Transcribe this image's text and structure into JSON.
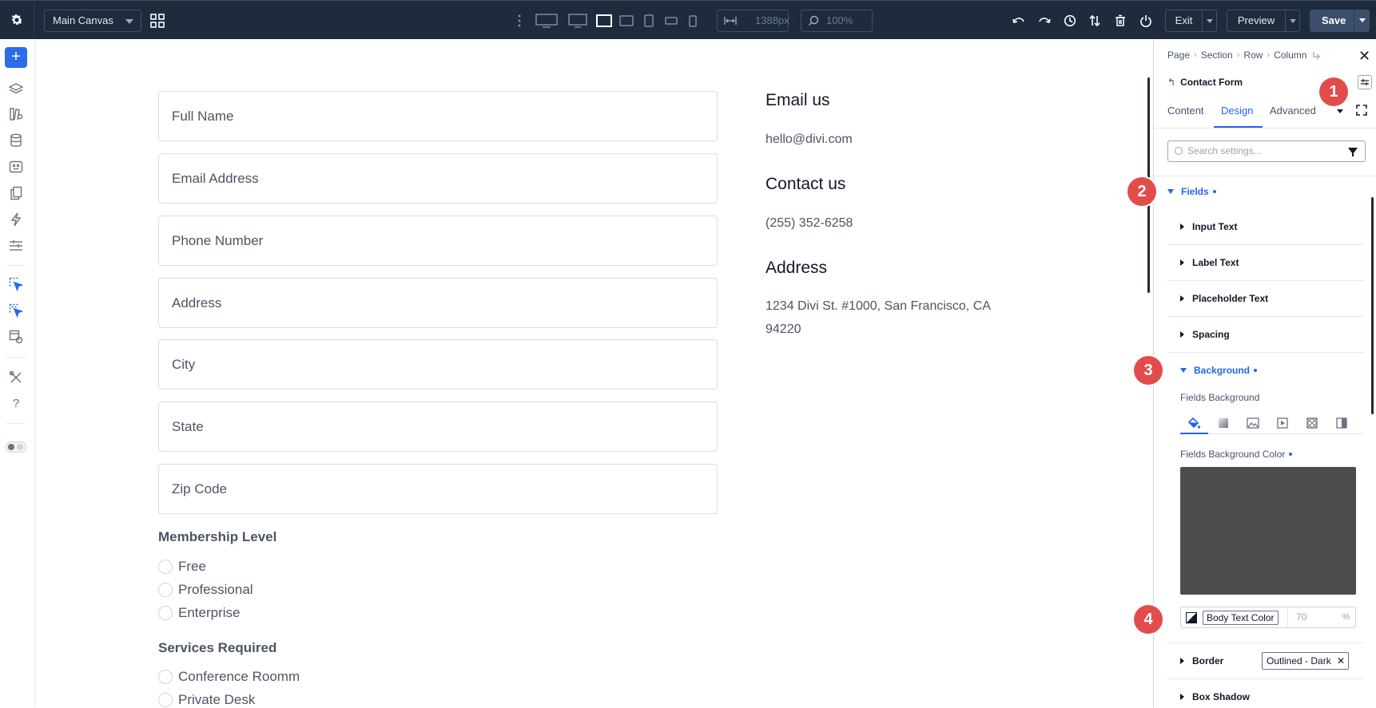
{
  "topbar": {
    "canvas_select": "Main Canvas",
    "width_value": "1388px",
    "zoom_value": "100%",
    "exit_label": "Exit",
    "preview_label": "Preview",
    "save_label": "Save",
    "colors": {
      "bar_bg": "#1e2b3c",
      "save_bg": "#3b4f6b"
    }
  },
  "leftbar": {
    "add_label": "+",
    "accent": "#2c6bea",
    "help_label": "?"
  },
  "form": {
    "fields": [
      "Full Name",
      "Email Address",
      "Phone Number",
      "Address",
      "City",
      "State",
      "Zip Code"
    ],
    "membership": {
      "title": "Membership Level",
      "options": [
        "Free",
        "Professional",
        "Enterprise"
      ]
    },
    "services": {
      "title": "Services Required",
      "options": [
        "Conference Roomm",
        "Private Desk"
      ]
    }
  },
  "contact_info": {
    "email_heading": "Email us",
    "email_value": "hello@divi.com",
    "phone_heading": "Contact us",
    "phone_value": "(255) 352-6258",
    "address_heading": "Address",
    "address_line1": "1234 Divi St. #1000, San Francisco, CA",
    "address_line2": "94220"
  },
  "panel": {
    "breadcrumb": [
      "Page",
      "Section",
      "Row",
      "Column"
    ],
    "module_title": "Contact Form",
    "tabs": [
      "Content",
      "Design",
      "Advanced"
    ],
    "active_tab": "Design",
    "search_placeholder": "Search settings...",
    "fields_group": "Fields",
    "sub_items": [
      "Input Text",
      "Label Text",
      "Placeholder Text",
      "Spacing"
    ],
    "background_group": "Background",
    "fields_background_label": "Fields Background",
    "fields_background_color_label": "Fields Background Color",
    "swatch_color": "#4c4c4c",
    "color_var_label": "Body Text Color",
    "opacity_value": "70",
    "opacity_unit": "%",
    "border_label": "Border",
    "border_value": "Outlined - Dark",
    "box_shadow_label": "Box Shadow",
    "accent": "#2563eb"
  },
  "callouts": {
    "c1": "1",
    "c2": "2",
    "c3": "3",
    "c4": "4",
    "color": "#e24c4b"
  }
}
